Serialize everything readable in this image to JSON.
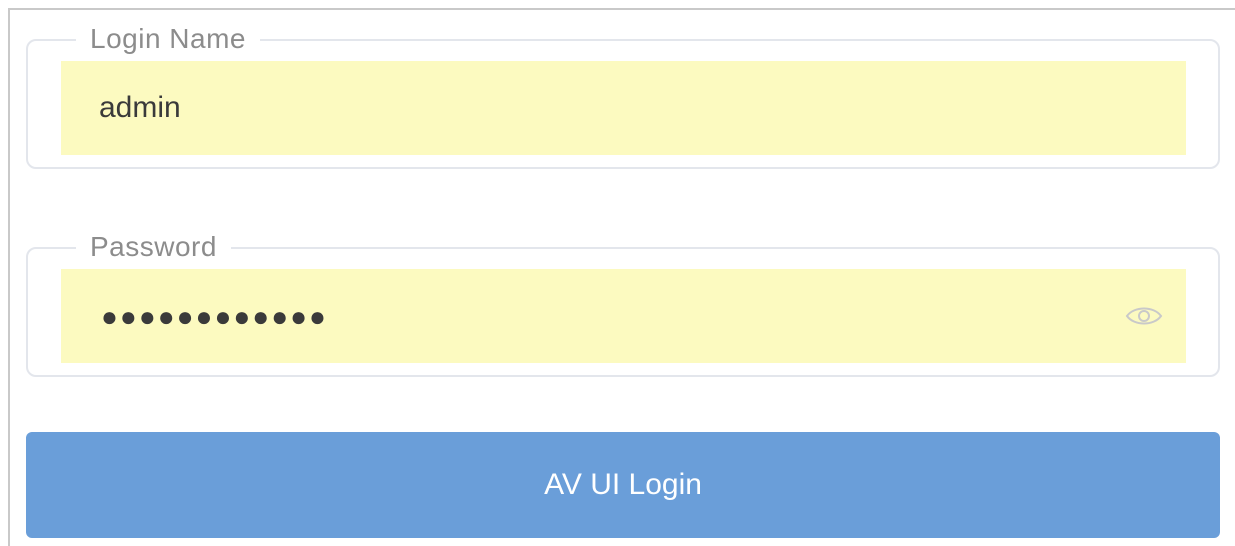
{
  "login_form": {
    "login_name": {
      "legend": "Login Name",
      "value": "admin"
    },
    "password": {
      "legend": "Password",
      "masked_value": "●●●●●●●●●●●●",
      "toggle_icon": "eye-icon"
    },
    "submit_label": "AV UI Login"
  },
  "colors": {
    "autofill_background": "#fcfac0",
    "button_background": "#6a9ed9",
    "button_text": "#ffffff",
    "legend_text": "#8c8c8c",
    "field_border": "#e3e6ec"
  }
}
